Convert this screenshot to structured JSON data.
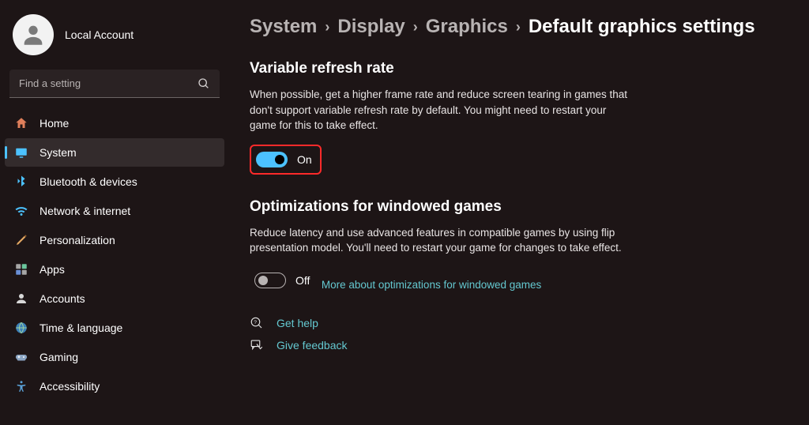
{
  "user": {
    "name": "Local Account"
  },
  "search": {
    "placeholder": "Find a setting"
  },
  "sidebar": {
    "items": [
      {
        "label": "Home"
      },
      {
        "label": "System"
      },
      {
        "label": "Bluetooth & devices"
      },
      {
        "label": "Network & internet"
      },
      {
        "label": "Personalization"
      },
      {
        "label": "Apps"
      },
      {
        "label": "Accounts"
      },
      {
        "label": "Time & language"
      },
      {
        "label": "Gaming"
      },
      {
        "label": "Accessibility"
      }
    ],
    "selectedIndex": 1
  },
  "breadcrumb": {
    "items": [
      "System",
      "Display",
      "Graphics",
      "Default graphics settings"
    ]
  },
  "sections": {
    "vrr": {
      "title": "Variable refresh rate",
      "desc": "When possible, get a higher frame rate and reduce screen tearing in games that don't support variable refresh rate by default. You might need to restart your game for this to take effect.",
      "toggleState": "On",
      "toggleOn": true
    },
    "windowed": {
      "title": "Optimizations for windowed games",
      "desc": "Reduce latency and use advanced features in compatible games by using flip presentation model. You'll need to restart your game for changes to take effect.",
      "toggleState": "Off",
      "toggleOn": false,
      "learnMore": "More about optimizations for windowed games"
    }
  },
  "help": {
    "getHelp": "Get help",
    "feedback": "Give feedback"
  }
}
